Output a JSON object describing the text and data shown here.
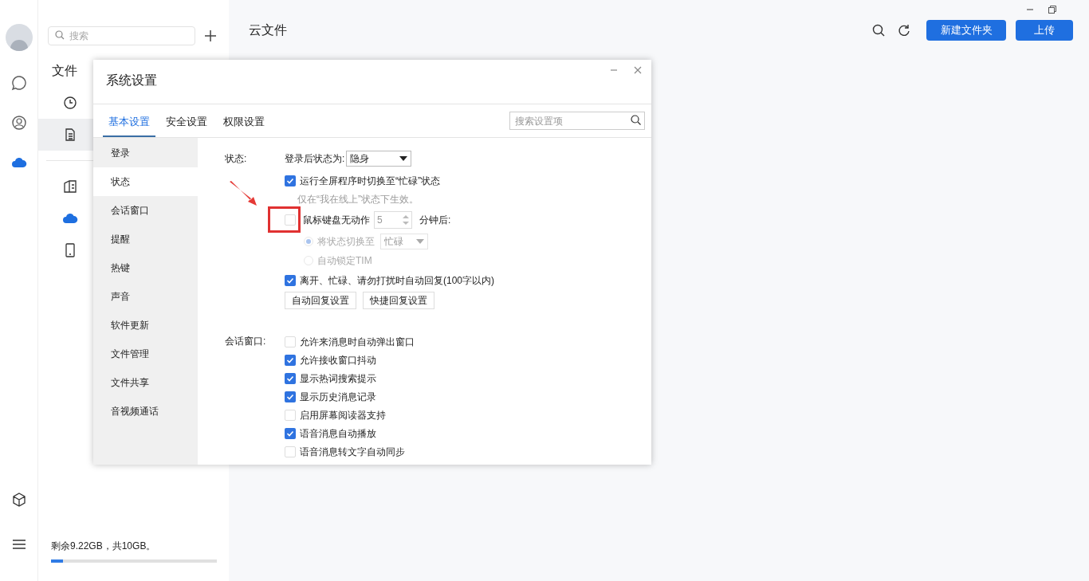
{
  "rail": {
    "items": [
      {
        "kind": "chat",
        "selected": false
      },
      {
        "kind": "contacts",
        "selected": false
      },
      {
        "kind": "cloud",
        "selected": true
      }
    ],
    "bottom": [
      {
        "kind": "cube"
      },
      {
        "kind": "menu"
      }
    ]
  },
  "sidebar": {
    "search": {
      "placeholder": "搜索"
    },
    "section_title": "文件",
    "items": [
      {
        "kind": "clock",
        "selected": false
      },
      {
        "kind": "doc",
        "selected": true
      }
    ],
    "items2": [
      {
        "kind": "building"
      },
      {
        "kind": "cloud"
      },
      {
        "kind": "phone"
      }
    ],
    "storage": {
      "text": "剩余9.22GB，共10GB。",
      "level": 0.07
    }
  },
  "main": {
    "title": "云文件",
    "buttons": [
      "新建文件夹",
      "上传"
    ]
  },
  "dialog": {
    "title": "系统设置",
    "tabs": [
      {
        "label": "基本设置",
        "selected": true
      },
      {
        "label": "安全设置",
        "selected": false
      },
      {
        "label": "权限设置",
        "selected": false
      }
    ],
    "search": {
      "placeholder": "搜索设置项"
    },
    "nav": [
      {
        "label": "登录",
        "selected": false
      },
      {
        "label": "状态",
        "selected": true
      },
      {
        "label": "会话窗口",
        "selected": false
      },
      {
        "label": "提醒",
        "selected": false
      },
      {
        "label": "热键",
        "selected": false
      },
      {
        "label": "声音",
        "selected": false
      },
      {
        "label": "软件更新",
        "selected": false
      },
      {
        "label": "文件管理",
        "selected": false
      },
      {
        "label": "文件共享",
        "selected": false
      },
      {
        "label": "音视频通话",
        "selected": false
      }
    ],
    "sections": [
      {
        "label": "状态:",
        "items": [
          {
            "kind": "select",
            "label": "登录后状态为:",
            "value": "隐身"
          },
          {
            "kind": "checkbox",
            "label": "运行全屏程序时切换至“忙碌”状态",
            "checked": true
          },
          {
            "kind": "hint",
            "label": "仅在“我在线上”状态下生效。"
          },
          {
            "kind": "spinner",
            "label": "鼠标键盘无动作",
            "checked": false,
            "value": "5",
            "suffix": "分钟后:",
            "highlighted": true
          },
          {
            "kind": "radio",
            "label": "将状态切换至",
            "selected": true,
            "disabled": true,
            "value": "忙碌"
          },
          {
            "kind": "radio",
            "label": "自动锁定TIM",
            "selected": false,
            "disabled": true
          },
          {
            "kind": "checkbox",
            "label": "离开、忙碌、请勿打扰时自动回复(100字以内)",
            "checked": true
          },
          {
            "kind": "buttons",
            "buttons": [
              "自动回复设置",
              "快捷回复设置"
            ]
          }
        ]
      },
      {
        "label": "会话窗口:",
        "items": [
          {
            "kind": "checkbox",
            "label": "允许来消息时自动弹出窗口",
            "checked": false
          },
          {
            "kind": "checkbox",
            "label": "允许接收窗口抖动",
            "checked": true
          },
          {
            "kind": "checkbox",
            "label": "显示热词搜索提示",
            "checked": true
          },
          {
            "kind": "checkbox",
            "label": "显示历史消息记录",
            "checked": true
          },
          {
            "kind": "checkbox",
            "label": "启用屏幕阅读器支持",
            "checked": false
          },
          {
            "kind": "checkbox",
            "label": "语音消息自动播放",
            "checked": true
          },
          {
            "kind": "checkbox",
            "label": "语音消息转文字自动同步",
            "checked": false
          }
        ]
      }
    ]
  }
}
